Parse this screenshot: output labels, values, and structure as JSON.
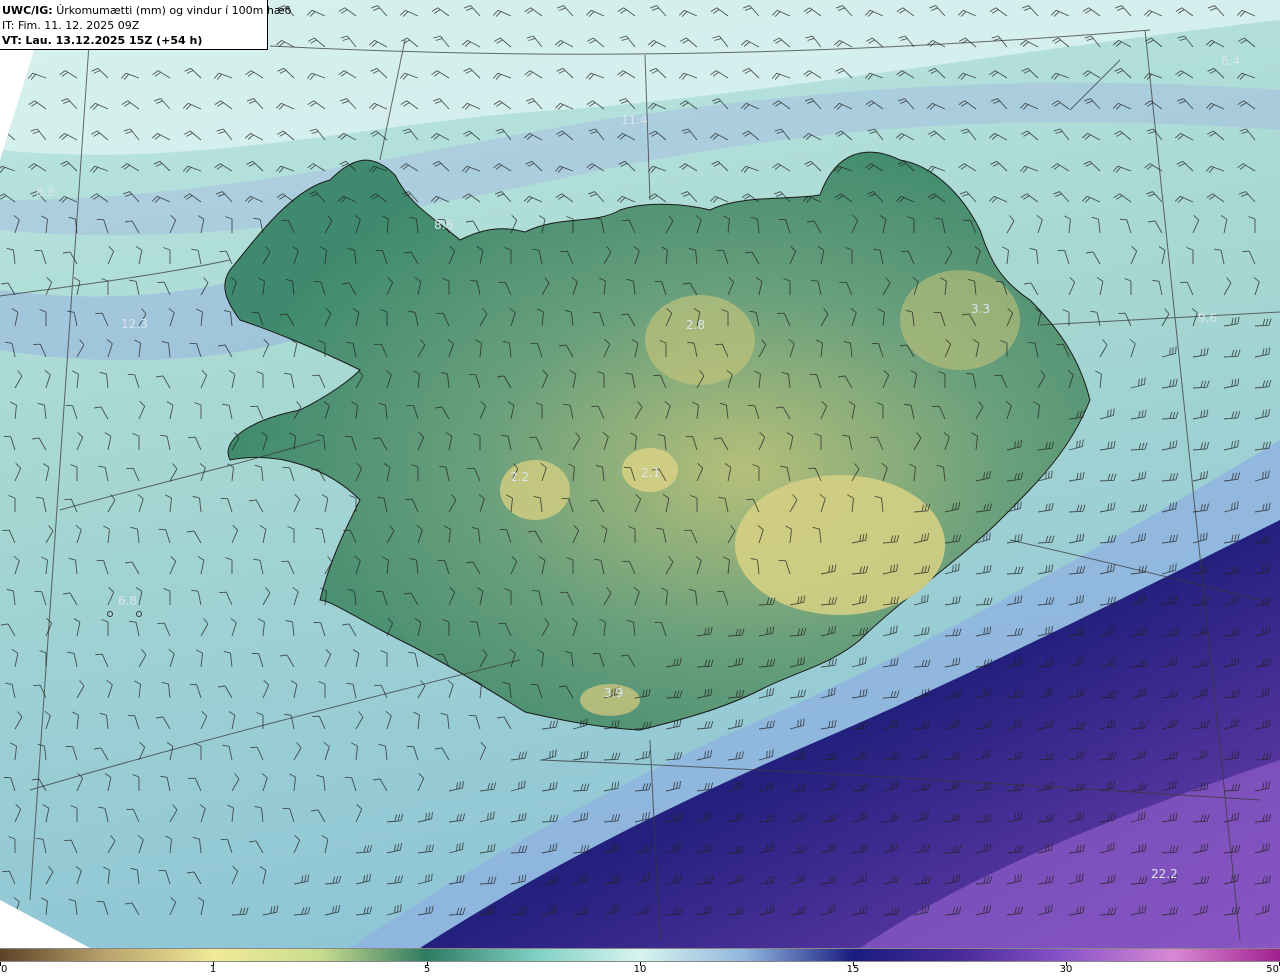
{
  "header": {
    "model_label": "UWC/IG:",
    "title": "Úrkomumætti (mm) og vindur í 100m hæð",
    "init_label": "IT:",
    "init_time": "Fim. 11. 12. 2025 09Z",
    "valid_label": "VT:",
    "valid_time": "Lau. 13.12.2025 15Z (+54 h)"
  },
  "map_labels": [
    {
      "id": "nw-sea",
      "text": "6.4"
    },
    {
      "id": "north-sea",
      "text": "11.4"
    },
    {
      "id": "west-far",
      "text": "8.8"
    },
    {
      "id": "westfjords-bay",
      "text": "8.6"
    },
    {
      "id": "west-sea",
      "text": "12.3"
    },
    {
      "id": "north-highland",
      "text": "2.8"
    },
    {
      "id": "east-highland",
      "text": "3.3"
    },
    {
      "id": "east-sea",
      "text": "9.6"
    },
    {
      "id": "langjokull",
      "text": "2.2"
    },
    {
      "id": "hofsjokull",
      "text": "2.1"
    },
    {
      "id": "southwest-sea",
      "text": "6.8"
    },
    {
      "id": "eyjafjallajokull",
      "text": "3.9"
    },
    {
      "id": "southeast-sea",
      "text": "22.2"
    }
  ],
  "colorbar": {
    "labels": [
      "0",
      "1",
      "5",
      "10",
      "15",
      "30",
      "50"
    ],
    "colors": [
      "#5c4328",
      "#b9a46c",
      "#f1ea98",
      "#c9dc8e",
      "#2f7a62",
      "#7ecfc3",
      "#d8f4f0",
      "#8fb4dc",
      "#191c80",
      "#4a2a9a",
      "#8a55c8",
      "#d889d4",
      "#a0208e"
    ]
  }
}
